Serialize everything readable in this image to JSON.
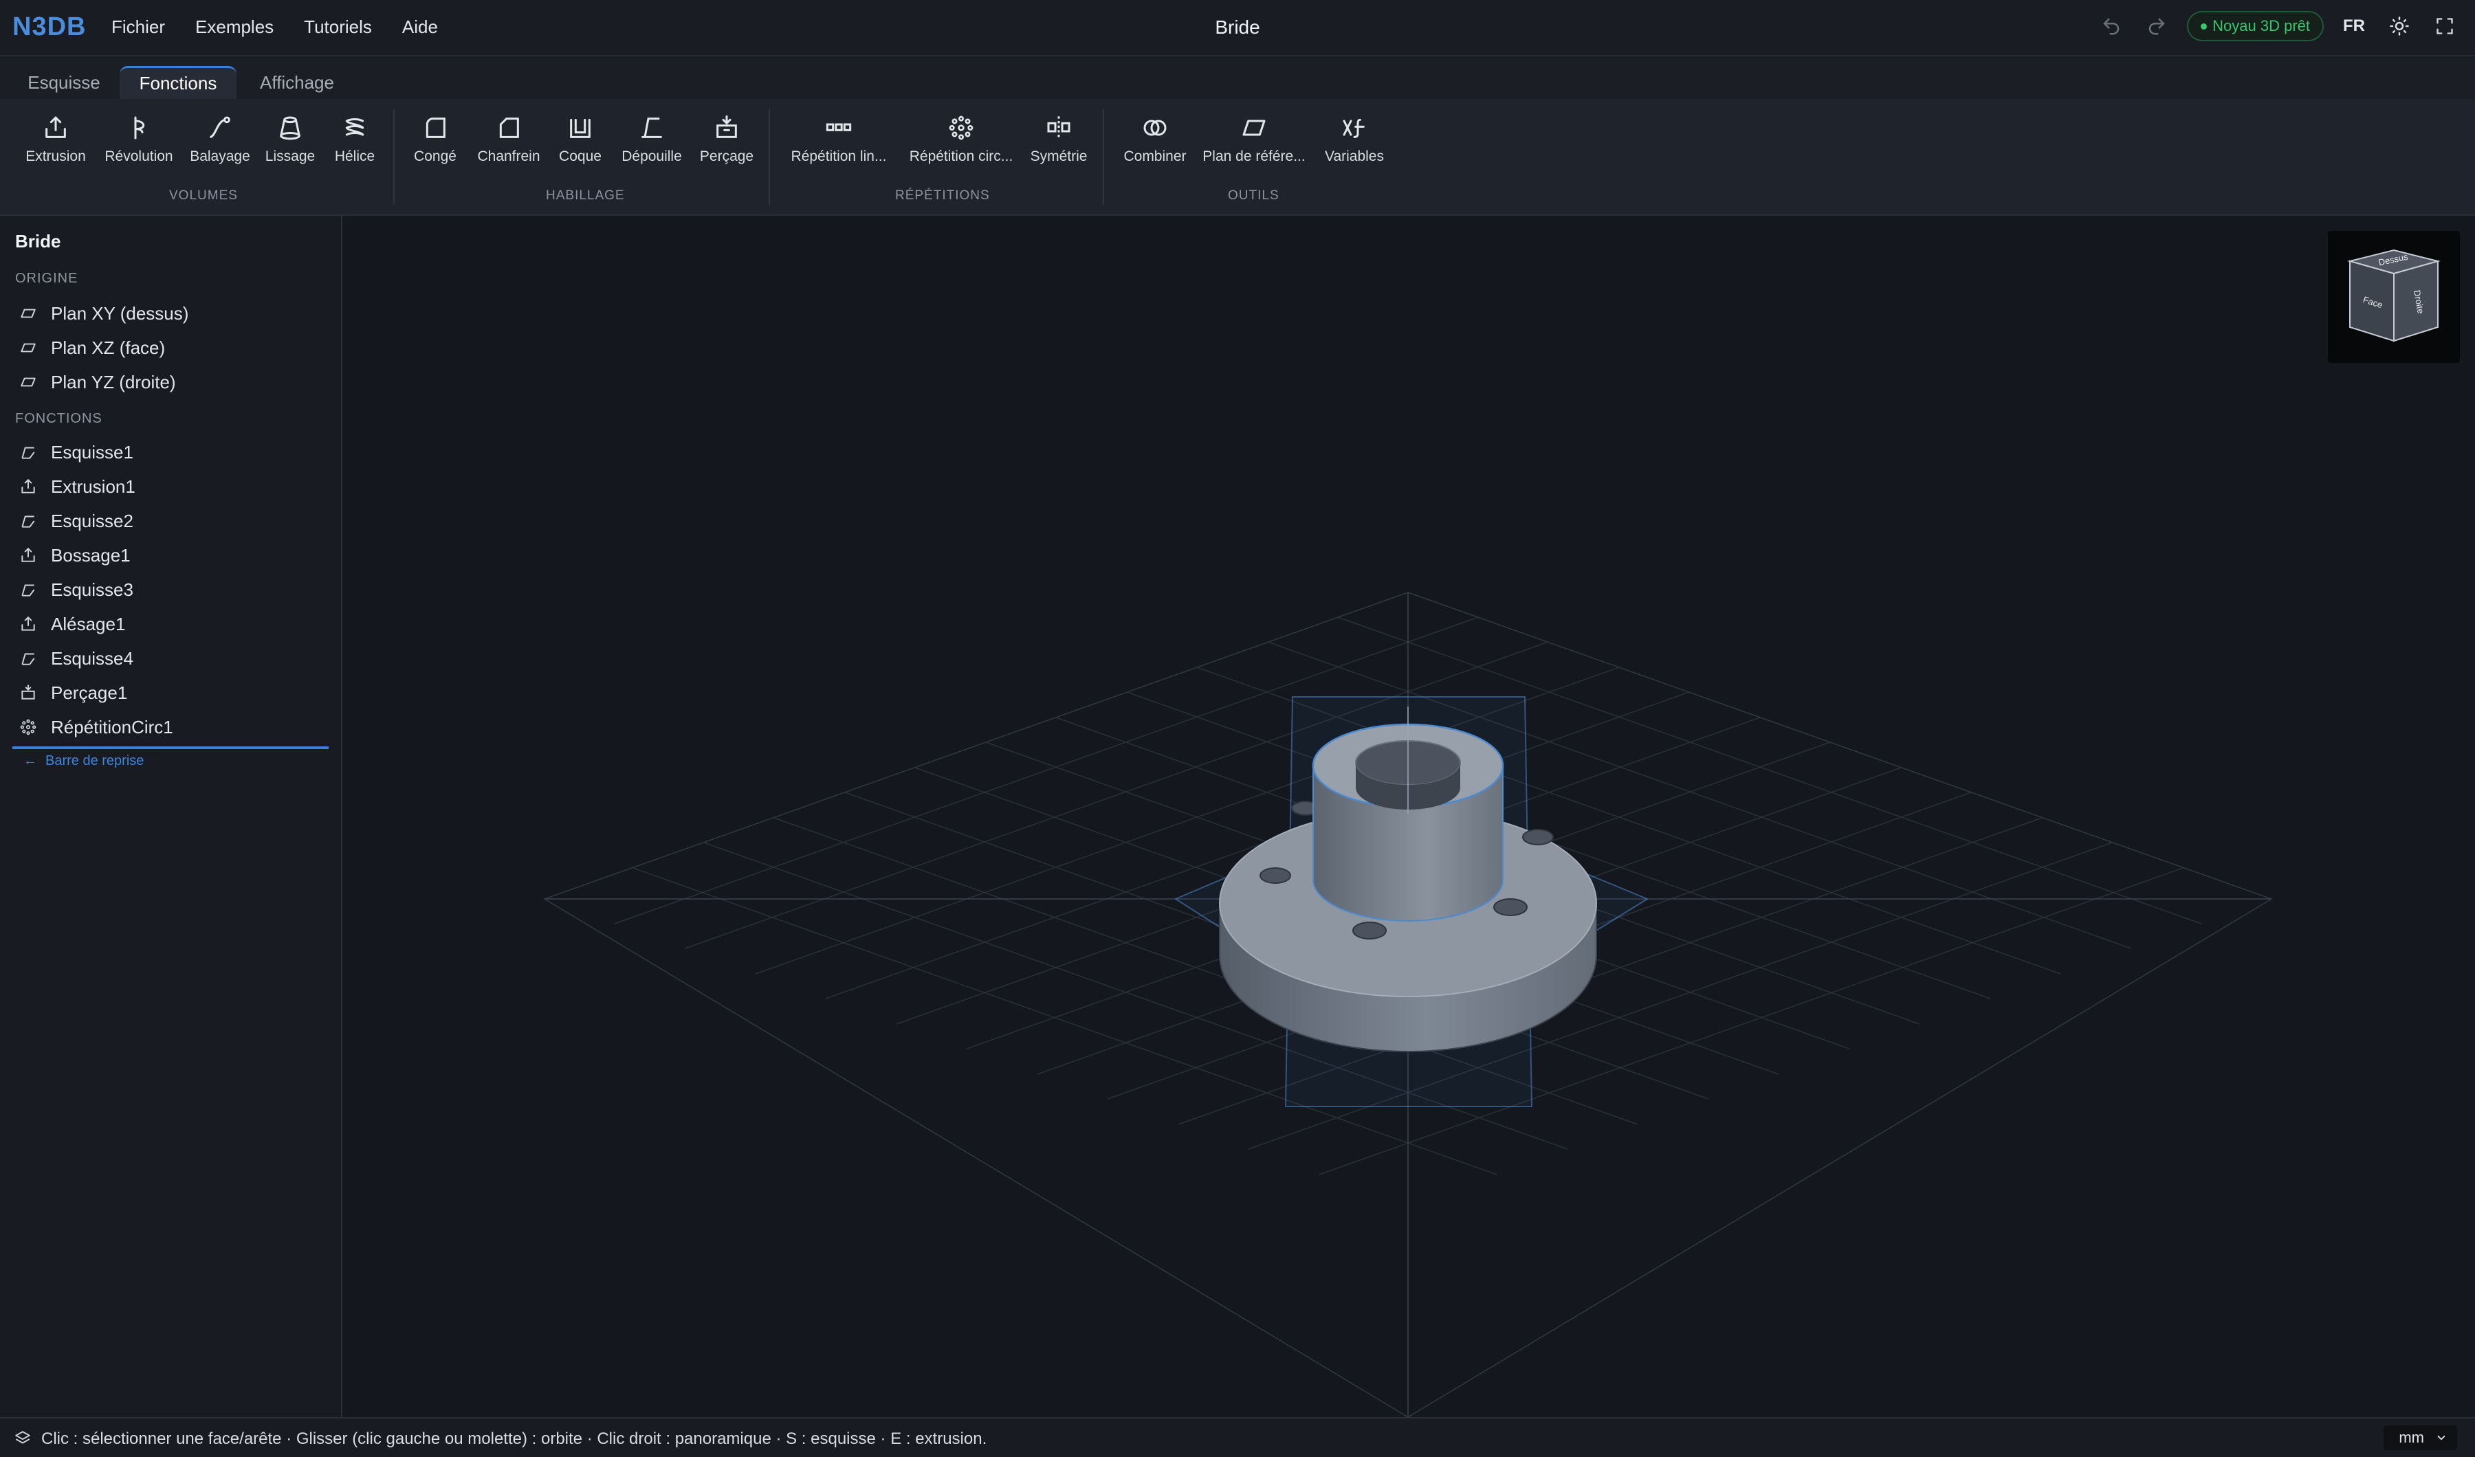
{
  "app": {
    "logo": "N3DB",
    "document_title": "Bride",
    "status": "Noyau 3D prêt",
    "language": "FR"
  },
  "menu": [
    "Fichier",
    "Exemples",
    "Tutoriels",
    "Aide"
  ],
  "tabs": [
    {
      "label": "Esquisse",
      "active": false
    },
    {
      "label": "Fonctions",
      "active": true
    },
    {
      "label": "Affichage",
      "active": false
    }
  ],
  "ribbon": {
    "groups": [
      "VOLUMES",
      "HABILLAGE",
      "RÉPÉTITIONS",
      "OUTILS"
    ],
    "buttons": [
      {
        "label": "Extrusion",
        "icon": "extrude-icon"
      },
      {
        "label": "Révolution",
        "icon": "revolve-icon"
      },
      {
        "label": "Balayage",
        "icon": "sweep-icon"
      },
      {
        "label": "Lissage",
        "icon": "loft-icon"
      },
      {
        "label": "Hélice",
        "icon": "helix-icon"
      },
      {
        "label": "Congé",
        "icon": "fillet-icon"
      },
      {
        "label": "Chanfrein",
        "icon": "chamfer-icon"
      },
      {
        "label": "Coque",
        "icon": "shell-icon"
      },
      {
        "label": "Dépouille",
        "icon": "draft-icon"
      },
      {
        "label": "Perçage",
        "icon": "hole-icon"
      },
      {
        "label": "Répétition lin...",
        "icon": "linear-pattern-icon"
      },
      {
        "label": "Répétition circ...",
        "icon": "circular-pattern-icon"
      },
      {
        "label": "Symétrie",
        "icon": "mirror-icon"
      },
      {
        "label": "Combiner",
        "icon": "combine-icon"
      },
      {
        "label": "Plan de référe...",
        "icon": "reference-plane-icon"
      },
      {
        "label": "Variables",
        "icon": "variables-icon"
      }
    ]
  },
  "tree": {
    "root": "Bride",
    "origin_label": "ORIGINE",
    "origin": [
      {
        "label": "Plan XY (dessus)",
        "icon": "plane-icon"
      },
      {
        "label": "Plan XZ (face)",
        "icon": "plane-icon"
      },
      {
        "label": "Plan YZ (droite)",
        "icon": "plane-icon"
      }
    ],
    "features_label": "FONCTIONS",
    "features": [
      {
        "label": "Esquisse1",
        "icon": "sketch-icon"
      },
      {
        "label": "Extrusion1",
        "icon": "extrude-icon"
      },
      {
        "label": "Esquisse2",
        "icon": "sketch-icon"
      },
      {
        "label": "Bossage1",
        "icon": "extrude-icon"
      },
      {
        "label": "Esquisse3",
        "icon": "sketch-icon"
      },
      {
        "label": "Alésage1",
        "icon": "extrude-icon"
      },
      {
        "label": "Esquisse4",
        "icon": "sketch-icon"
      },
      {
        "label": "Perçage1",
        "icon": "hole-icon"
      },
      {
        "label": "RépétitionCirc1",
        "icon": "circular-pattern-icon"
      }
    ],
    "rollback_label": "Barre de reprise"
  },
  "navcube": {
    "top": "Dessus",
    "front": "Face",
    "right": "Droite"
  },
  "statusbar": {
    "hint": "Clic : sélectionner une face/arête · Glisser (clic gauche ou molette) : orbite · Clic droit : panoramique · S : esquisse · E : extrusion.",
    "unit": "mm"
  },
  "colors": {
    "accent": "#3a7fd8",
    "status_green": "#39c66f",
    "background": "#14171d"
  }
}
